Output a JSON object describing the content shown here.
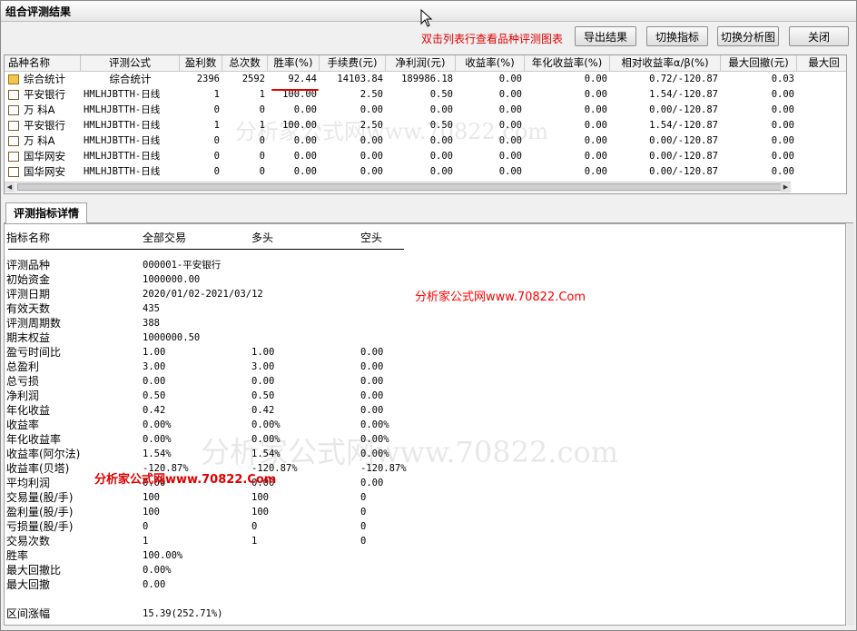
{
  "window": {
    "title": "组合评测结果"
  },
  "hint": "双击列表行查看品种评测图表",
  "buttons": {
    "export": "导出结果",
    "switch_indicator": "切换指标",
    "switch_analysis": "切换分析图",
    "close": "关闭"
  },
  "grid": {
    "headers": [
      "品种名称",
      "评测公式",
      "盈利数",
      "总次数",
      "胜率(%)",
      "手续费(元)",
      "净利润(元)",
      "收益率(%)",
      "年化收益率(%)",
      "相对收益率α/β(%)",
      "最大回撤(元)",
      "最大回"
    ],
    "rows": [
      [
        "综合统计",
        "综合统计",
        "2396",
        "2592",
        "92.44",
        "14103.84",
        "189986.18",
        "0.00",
        "0.00",
        "0.72/-120.87",
        "0.03",
        ""
      ],
      [
        "平安银行",
        "HMLHJBTTH-日线",
        "1",
        "1",
        "100.00",
        "2.50",
        "0.50",
        "0.00",
        "0.00",
        "1.54/-120.87",
        "0.00",
        ""
      ],
      [
        "万 科A",
        "HMLHJBTTH-日线",
        "0",
        "0",
        "0.00",
        "0.00",
        "0.00",
        "0.00",
        "0.00",
        "0.00/-120.87",
        "0.00",
        ""
      ],
      [
        "平安银行",
        "HMLHJBTTH-日线",
        "1",
        "1",
        "100.00",
        "2.50",
        "0.50",
        "0.00",
        "0.00",
        "1.54/-120.87",
        "0.00",
        ""
      ],
      [
        "万 科A",
        "HMLHJBTTH-日线",
        "0",
        "0",
        "0.00",
        "0.00",
        "0.00",
        "0.00",
        "0.00",
        "0.00/-120.87",
        "0.00",
        ""
      ],
      [
        "国华网安",
        "HMLHJBTTH-日线",
        "0",
        "0",
        "0.00",
        "0.00",
        "0.00",
        "0.00",
        "0.00",
        "0.00/-120.87",
        "0.00",
        ""
      ],
      [
        "国华网安",
        "HMLHJBTTH-日线",
        "0",
        "0",
        "0.00",
        "0.00",
        "0.00",
        "0.00",
        "0.00",
        "0.00/-120.87",
        "0.00",
        ""
      ]
    ]
  },
  "tab": {
    "label": "评测指标详情"
  },
  "detail": {
    "headers": [
      "指标名称",
      "全部交易",
      "多头",
      "空头"
    ],
    "rows": [
      [
        "评测品种",
        "000001-平安银行",
        "",
        ""
      ],
      [
        "初始资金",
        "1000000.00",
        "",
        ""
      ],
      [
        "评测日期",
        "2020/01/02-2021/03/12",
        "",
        ""
      ],
      [
        "有效天数",
        "435",
        "",
        ""
      ],
      [
        "评测周期数",
        "388",
        "",
        ""
      ],
      [
        "期末权益",
        "1000000.50",
        "",
        ""
      ],
      [
        "盈亏时间比",
        "1.00",
        "1.00",
        "0.00"
      ],
      [
        "总盈利",
        "3.00",
        "3.00",
        "0.00"
      ],
      [
        "总亏损",
        "0.00",
        "0.00",
        "0.00"
      ],
      [
        "净利润",
        "0.50",
        "0.50",
        "0.00"
      ],
      [
        "年化收益",
        "0.42",
        "0.42",
        "0.00"
      ],
      [
        "收益率",
        "0.00%",
        "0.00%",
        "0.00%"
      ],
      [
        "年化收益率",
        "0.00%",
        "0.00%",
        "0.00%"
      ],
      [
        "收益率(阿尔法)",
        "1.54%",
        "1.54%",
        "0.00%"
      ],
      [
        "收益率(贝塔)",
        "-120.87%",
        "-120.87%",
        "-120.87%"
      ],
      [
        "平均利润",
        "0.00",
        "0.00",
        "0.00"
      ],
      [
        "交易量(股/手)",
        "100",
        "100",
        "0"
      ],
      [
        "盈利量(股/手)",
        "100",
        "100",
        "0"
      ],
      [
        "亏损量(股/手)",
        "0",
        "0",
        "0"
      ],
      [
        "交易次数",
        "1",
        "1",
        "0"
      ],
      [
        "胜率",
        "100.00%",
        "",
        ""
      ],
      [
        "最大回撤比",
        "0.00%",
        "",
        ""
      ],
      [
        "最大回撤",
        "0.00",
        "",
        ""
      ],
      [
        "",
        "",
        "",
        ""
      ],
      [
        "区间涨幅",
        "15.39(252.71%)",
        "",
        ""
      ]
    ]
  },
  "watermarks": {
    "grey1": "分析家公式网www.70822.com",
    "grey2": "分析家公式网www.70822.com",
    "red1": "分析家公式网www.70822.Com",
    "red2": "分析家公式网www.70822.Com"
  }
}
